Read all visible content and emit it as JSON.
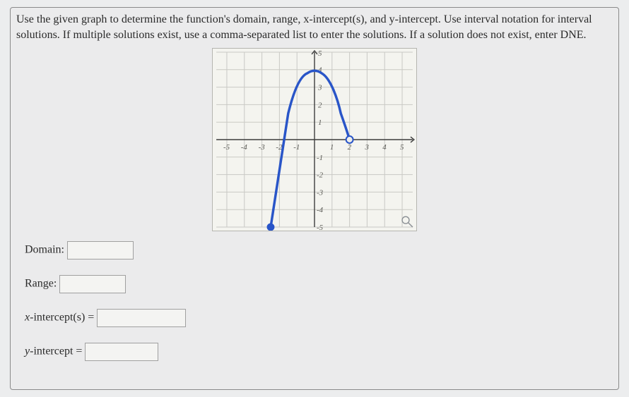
{
  "instructions": "Use the given graph to determine the function's domain, range, x-intercept(s), and y-intercept. Use interval notation for interval solutions. If multiple solutions exist, use a comma-separated list to enter the solutions. If a solution does not exist, enter DNE.",
  "labels": {
    "domain": "Domain:",
    "range": "Range:",
    "xint_prefix": "x",
    "xint_suffix": "-intercept(s) =",
    "yint_prefix": "y",
    "yint_suffix": "-intercept ="
  },
  "fields": {
    "domain": "",
    "range": "",
    "xintercepts": "",
    "yintercept": ""
  },
  "chart_data": {
    "type": "line",
    "xlim": [
      -5,
      5
    ],
    "ylim": [
      -5,
      5
    ],
    "xticks": [
      -5,
      -4,
      -3,
      -2,
      -1,
      1,
      2,
      3,
      4,
      5
    ],
    "yticks": [
      -5,
      -4,
      -3,
      -2,
      -1,
      1,
      2,
      3,
      4,
      5
    ],
    "curve_points": [
      {
        "x": -2.5,
        "y": -5,
        "closed": true
      },
      {
        "x": -2.0,
        "y": -1.0
      },
      {
        "x": -1.5,
        "y": 1.5
      },
      {
        "x": -1.0,
        "y": 3.0
      },
      {
        "x": -0.4,
        "y": 3.8
      },
      {
        "x": 0.0,
        "y": 4.0
      },
      {
        "x": 0.4,
        "y": 3.8
      },
      {
        "x": 1.0,
        "y": 3.0
      },
      {
        "x": 1.5,
        "y": 1.5
      },
      {
        "x": 2.0,
        "y": 0.0,
        "open": true
      }
    ],
    "description": "Downward-opening parabola-like curve; closed endpoint at (-2.5, -5), vertex near (0, 4), open endpoint at (2, 0)."
  }
}
